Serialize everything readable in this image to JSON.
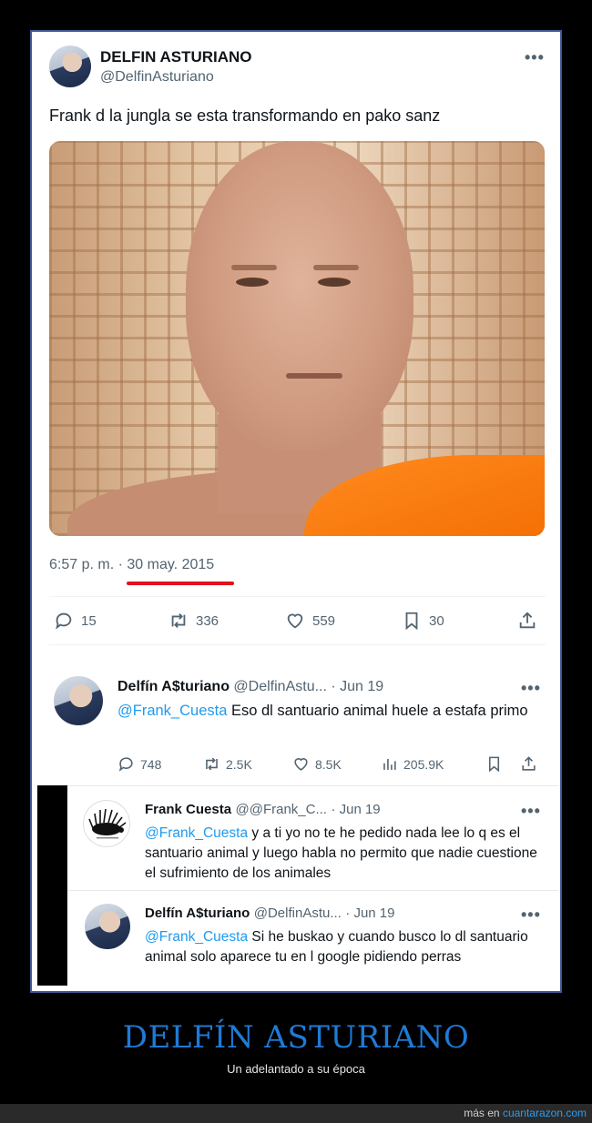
{
  "main_tweet": {
    "author_name": "DELFIN ASTURIANO",
    "author_handle": "@DelfinAsturiano",
    "more": "•••",
    "text": "Frank d la jungla se esta transformando en pako sanz",
    "time": "6:57 p. m.",
    "separator": "·",
    "date": "30 may. 2015",
    "actions": {
      "replies": "15",
      "retweets": "336",
      "likes": "559",
      "bookmarks": "30"
    }
  },
  "reply_1": {
    "author_name": "Delfín A$turiano",
    "author_handle": "@DelfinAstu...",
    "date": "· Jun 19",
    "more": "•••",
    "mention": "@Frank_Cuesta",
    "text": " Eso dl santuario animal huele a estafa primo",
    "actions": {
      "replies": "748",
      "retweets": "2.5K",
      "likes": "8.5K",
      "views": "205.9K"
    }
  },
  "reply_2": {
    "author_name": "Frank Cuesta",
    "author_handle": "@@Frank_C...",
    "date": "· Jun 19",
    "more": "•••",
    "mention": "@Frank_Cuesta",
    "text": " y a ti yo no te he pedido nada lee lo q es el santuario animal y luego habla no permito que nadie cuestione el sufrimiento de los animales"
  },
  "reply_3": {
    "author_name": "Delfín A$turiano",
    "author_handle": "@DelfinAstu...",
    "date": "· Jun 19",
    "more": "•••",
    "mention": "@Frank_Cuesta",
    "text": " Si he buskao y cuando busco lo dl santuario animal solo aparece tu en l google pidiendo perras"
  },
  "footer": {
    "title": "DELFÍN ASTURIANO",
    "subtitle": "Un adelantado a su época",
    "more_prefix": "más en ",
    "site": "cuantarazon.com"
  },
  "colors": {
    "accent": "#1d9bf0",
    "highlight_underline": "#e0101c",
    "footer_title": "#1f7ad6",
    "robe": "#f26b00"
  }
}
